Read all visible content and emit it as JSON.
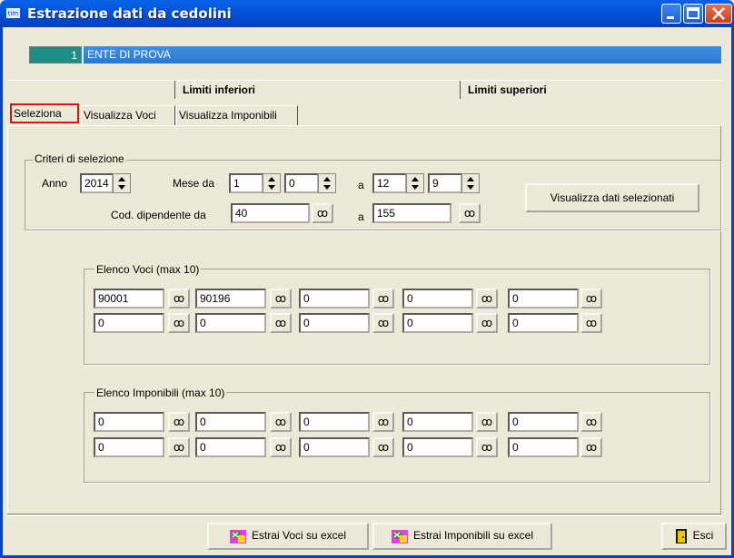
{
  "window": {
    "title": "Estrazione dati da cedolini",
    "icon_text": "tim"
  },
  "ente": {
    "code": "1",
    "name": "ENTE DI PROVA"
  },
  "headers": {
    "lower": "Limiti inferiori",
    "upper": "Limiti superiori"
  },
  "tabs": [
    {
      "label": "Seleziona",
      "active": true
    },
    {
      "label": "Visualizza Voci",
      "active": false
    },
    {
      "label": "Visualizza Imponibili",
      "active": false
    }
  ],
  "criteria": {
    "title": "Criteri di selezione",
    "anno_label": "Anno",
    "anno_value": "2014",
    "mese_da_label": "Mese da",
    "mese_da_1": "1",
    "mese_da_2": "0",
    "a_label": "a",
    "mese_a_1": "12",
    "mese_a_2": "9",
    "cod_label": "Cod. dipendente da",
    "cod_da": "40",
    "cod_a": "155",
    "view_button": "Visualizza dati selezionati"
  },
  "voci": {
    "title": "Elenco Voci (max 10)",
    "row1": [
      "90001",
      "90196",
      "0",
      "0",
      "0"
    ],
    "row2": [
      "0",
      "0",
      "0",
      "0",
      "0"
    ]
  },
  "imponibili": {
    "title": "Elenco Imponibili (max 10)",
    "row1": [
      "0",
      "0",
      "0",
      "0",
      "0"
    ],
    "row2": [
      "0",
      "0",
      "0",
      "0",
      "0"
    ]
  },
  "footer": {
    "estrai_voci": "Estrai Voci su excel",
    "estrai_imponibili": "Estrai Imponibili su excel",
    "esci": "Esci"
  },
  "colors": {
    "title_blue": "#0453d8",
    "ente_teal": "#1f8c86",
    "active_tab_border": "#e01010"
  }
}
